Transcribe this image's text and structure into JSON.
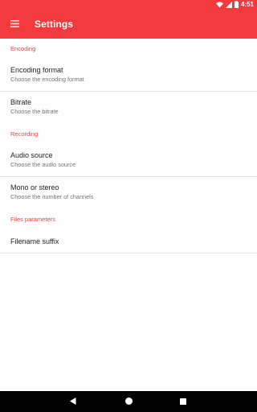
{
  "status_bar": {
    "time": "4:51",
    "icons": [
      "wifi-icon",
      "cellular-icon",
      "battery-icon"
    ]
  },
  "app_bar": {
    "title": "Settings",
    "icon": "menu-icon",
    "color": "#f23a3f"
  },
  "sections": [
    {
      "header": "Encoding",
      "items": [
        {
          "title": "Encoding format",
          "summary": "Choose the encoding format"
        },
        {
          "title": "Bitrate",
          "summary": "Choose the bitrate"
        }
      ]
    },
    {
      "header": "Recording",
      "items": [
        {
          "title": "Audio source",
          "summary": "Choose the audio source"
        },
        {
          "title": "Mono or stereo",
          "summary": "Choose the number of channels"
        }
      ]
    },
    {
      "header": "Files parameters",
      "items": [
        {
          "title": "Filename suffix"
        }
      ]
    }
  ],
  "nav_bar": {
    "icons": [
      "back-icon",
      "home-icon",
      "recents-icon"
    ]
  }
}
